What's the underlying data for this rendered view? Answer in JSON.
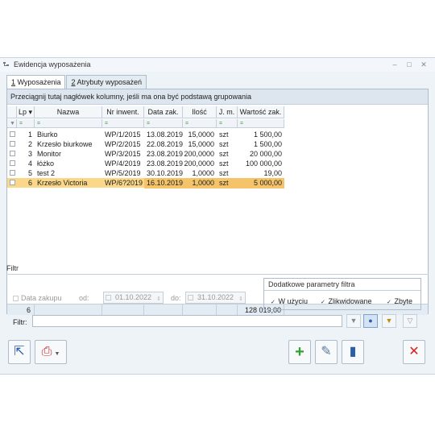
{
  "window": {
    "title": "Ewidencja wyposażenia",
    "controls": [
      "–",
      "□",
      "✕"
    ]
  },
  "tabs": [
    {
      "num": "1",
      "label": " Wyposażenia",
      "active": true
    },
    {
      "num": "2",
      "label": " Atrybuty wyposażeń",
      "active": false
    }
  ],
  "grid": {
    "group_hint": "Przeciągnij tutaj nagłówek kolumny, jeśli ma ona być podstawą grupowania",
    "columns": [
      "Lp ▾",
      "Nazwa",
      "Nr inwent.",
      "Data zak.",
      "Ilość",
      "J. m.",
      "Wartość zak."
    ],
    "filter_symbols": [
      "=",
      "=",
      "=",
      "=",
      "=",
      "=",
      "="
    ],
    "rows": [
      {
        "lp": "1",
        "nazwa": "Biurko",
        "nr": "WP/1/2015",
        "data": "13.08.2019",
        "ilosc": "15,0000",
        "jm": "szt",
        "wartosc": "1 500,00",
        "selected": false
      },
      {
        "lp": "2",
        "nazwa": "Krzesło biurkowe",
        "nr": "WP/2/2015",
        "data": "22.08.2019",
        "ilosc": "15,0000",
        "jm": "szt",
        "wartosc": "1 500,00",
        "selected": false
      },
      {
        "lp": "3",
        "nazwa": "Monitor",
        "nr": "WP/3/2015",
        "data": "23.08.2019",
        "ilosc": "200,0000",
        "jm": "szt",
        "wartosc": "20 000,00",
        "selected": false
      },
      {
        "lp": "4",
        "nazwa": "łóżko",
        "nr": "WP/4/2019",
        "data": "23.08.2019",
        "ilosc": "200,0000",
        "jm": "szt",
        "wartosc": "100 000,00",
        "selected": false
      },
      {
        "lp": "5",
        "nazwa": "test 2",
        "nr": "WP/5/2019",
        "data": "30.10.2019",
        "ilosc": "1,0000",
        "jm": "szt",
        "wartosc": "19,00",
        "selected": false
      },
      {
        "lp": "6",
        "nazwa": "Krzesło Victoria",
        "nr": "WP/6?2019",
        "data": "16.10.2019",
        "ilosc": "1,0000",
        "jm": "szt",
        "wartosc": "5 000,00",
        "selected": true
      }
    ],
    "footer": {
      "count": "6",
      "total": "128 019,00"
    }
  },
  "filter": {
    "legend": "Filtr",
    "date_label": "Data zakupu",
    "od_label": "od:",
    "do_label": "do:",
    "od_value": "01.10.2022",
    "do_value": "31.10.2022",
    "options_title": "Dodatkowe parametry filtra",
    "options": [
      {
        "label": "W użyciu",
        "checked": true
      },
      {
        "label": "Zlikwidowane",
        "checked": true
      },
      {
        "label": "Zbyte",
        "checked": true
      }
    ],
    "filtr_label": "Filtr:",
    "filtr_value": ""
  },
  "colors": {
    "selected_row": "#fbd78a",
    "selected_row_cell": "#f5c46a",
    "accent_green": "#2ea32e",
    "accent_red": "#d92020"
  },
  "icons": {
    "title": "tree-icon",
    "filter_buttons": [
      "funnel-icon",
      "funnel-active-icon",
      "funnel-clear-icon",
      "funnel-disabled-icon"
    ],
    "bottom_left": [
      "export-icon",
      "print-menu-icon"
    ],
    "bottom_right": [
      "add-icon",
      "edit-icon",
      "delete-bin-icon",
      "close-icon"
    ]
  }
}
